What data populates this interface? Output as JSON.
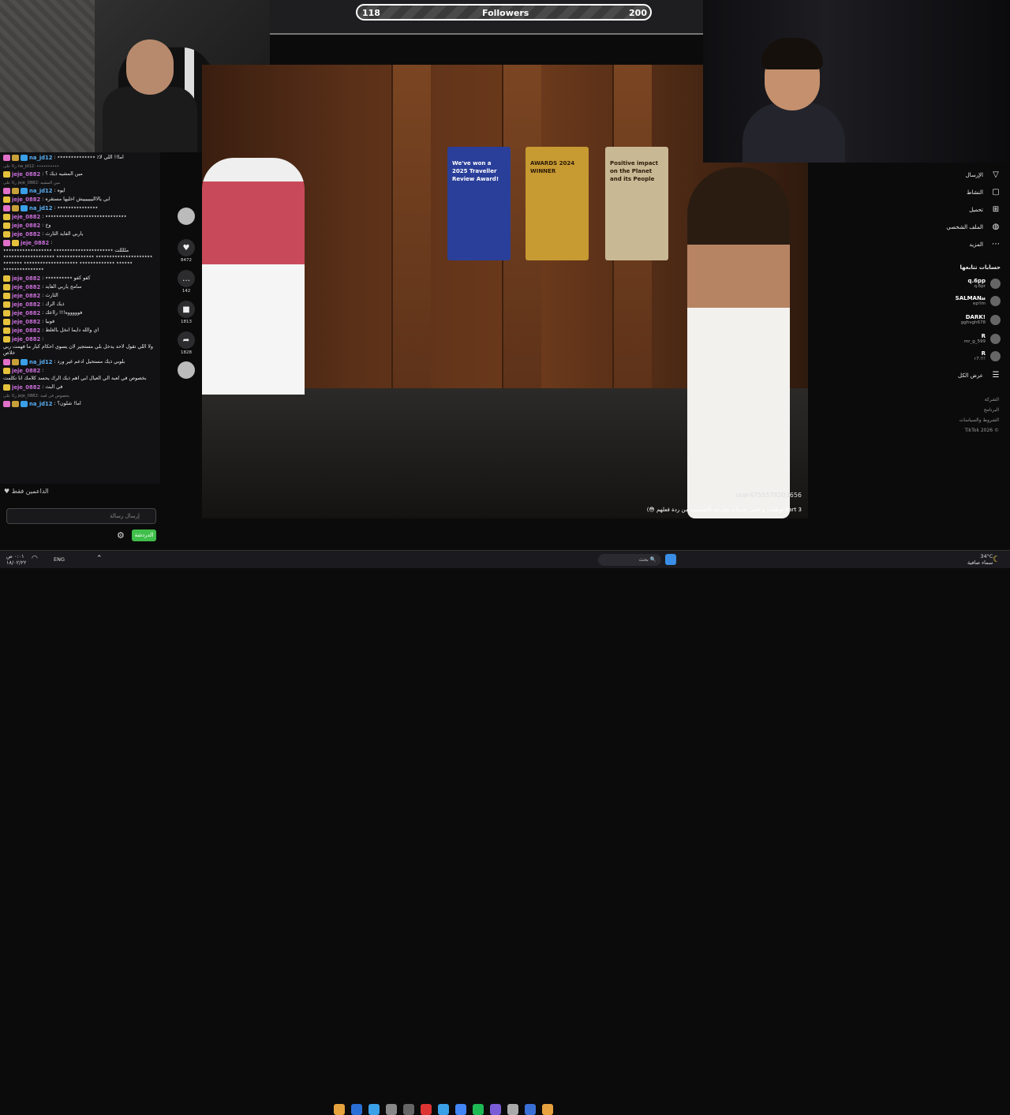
{
  "follower_goal": {
    "current": "118",
    "label": "Followers",
    "target": "200",
    "progress": 0.59
  },
  "chat": {
    "messages": [
      {
        "reply": "",
        "user": "na_jd12",
        "text": "اما!! اللي لا٪ ٭٭٭٭٭٭٭٭٭٭٭٭٭٭",
        "badges": [
          "pink",
          "gold",
          "blue"
        ]
      },
      {
        "reply": "ردًا على na_jd12: ٭٭٭٭٭٭٭٭٭٭",
        "user": "jeje_0882",
        "text": "مين المشيه ذيك ؟",
        "badges": [
          "yel"
        ]
      },
      {
        "reply": "ردًا على jeje_0882: مين المشيه",
        "user": "na_jd12",
        "text": "ايوه",
        "badges": [
          "pink",
          "gold",
          "blue"
        ]
      },
      {
        "reply": "",
        "user": "jeje_0882",
        "text": "ابي يالااليييييييش اخليها مستقره",
        "badges": [
          "yel"
        ]
      },
      {
        "reply": "",
        "user": "na_jd12",
        "text": "٭٭٭٭٭٭٭٭٭٭٭٭٭٭٭",
        "badges": [
          "pink",
          "gold",
          "blue"
        ]
      },
      {
        "reply": "",
        "user": "jeje_0882",
        "text": "٭٭٭٭٭٭٭٭٭٭٭٭٭٭٭٭٭٭٭٭٭٭٭٭٭٭٭٭٭٭",
        "badges": [
          "yel"
        ]
      },
      {
        "reply": "",
        "user": "jeje_0882",
        "text": "وخ",
        "badges": [
          "yel"
        ]
      },
      {
        "reply": "",
        "user": "jeje_0882",
        "text": "ياربي الفايد الثارث",
        "badges": [
          "yel"
        ]
      },
      {
        "reply": "",
        "user": "jeje_0882",
        "text": "مللللت ٭٭٭٭٭٭٭٭٭٭٭٭٭٭٭٭٭٭٭٭٭٭ ٭٭٭٭٭٭٭٭٭٭٭٭٭٭٭٭٭٭ ٭٭٭٭٭٭٭٭٭٭٭٭٭٭٭٭٭٭٭٭٭ ٭٭٭٭٭٭٭٭٭٭٭٭٭٭ ٭٭٭٭٭٭٭٭٭٭٭٭٭٭٭٭٭٭٭ ٭٭٭٭٭٭ ٭٭٭٭٭٭٭٭٭٭٭٭٭ ٭٭٭٭٭٭٭٭٭٭٭٭٭٭٭٭٭٭٭٭ ٭٭٭٭٭٭٭ ٭٭٭٭٭٭٭٭٭٭٭٭٭٭٭",
        "badges": [
          "pink",
          "yel"
        ]
      },
      {
        "reply": "",
        "user": "jeje_0882",
        "text": "كفو كفو ٭٭٭٭٭٭٭٭٭٭",
        "badges": [
          "yel"
        ]
      },
      {
        "reply": "",
        "user": "jeje_0882",
        "text": "سامح ياربي الفايد",
        "badges": [
          "yel"
        ]
      },
      {
        "reply": "",
        "user": "jeje_0882",
        "text": "الثارث",
        "badges": [
          "yel"
        ]
      },
      {
        "reply": "",
        "user": "jeje_0882",
        "text": "ذيك الرك",
        "badges": [
          "yel"
        ]
      },
      {
        "reply": "",
        "user": "jeje_0882",
        "text": "فوووووه!!! رااعك",
        "badges": [
          "yel"
        ]
      },
      {
        "reply": "",
        "user": "jeje_0882",
        "text": "فوبيا",
        "badges": [
          "yel"
        ]
      },
      {
        "reply": "",
        "user": "jeje_0882",
        "text": "اي والله دايما انخل بالغلط",
        "badges": [
          "yel"
        ]
      },
      {
        "reply": "",
        "user": "jeje_0882",
        "text": "ولا اللي تقول لاحد يدخل بلي مستجير لان يسوي احكام كبار ما فهمت ربي خلاص",
        "badges": [
          "yel"
        ]
      },
      {
        "reply": "",
        "user": "na_jd12",
        "text": "بلوبي ذيك مستحيل ادعم غير ورد",
        "badges": [
          "pink",
          "gold",
          "blue"
        ]
      },
      {
        "reply": "",
        "user": "jeje_0882",
        "text": "بخصوص في لعبة الي العيال ابي اهم ذيك الرك يحسد كلامك انا تكلمت",
        "badges": [
          "yel"
        ]
      },
      {
        "reply": "",
        "user": "jeje_0882",
        "text": "في البث",
        "badges": [
          "yel"
        ]
      },
      {
        "reply": "ردًا على jeje_0882: بخصوص في لعبة",
        "user": "na_jd12",
        "text": "اما! شلون؟",
        "badges": [
          "pink",
          "gold",
          "blue"
        ]
      }
    ],
    "supporters_label": "الداعمين فقط",
    "input_placeholder": "إرسال رسالة",
    "send_button": "الدردشة"
  },
  "video": {
    "actions": [
      {
        "name": "like",
        "icon": "♥",
        "count": "8472"
      },
      {
        "name": "comment",
        "icon": "…",
        "count": "142"
      },
      {
        "name": "save",
        "icon": "■",
        "count": "1813"
      },
      {
        "name": "share",
        "icon": "➦",
        "count": "1828"
      }
    ],
    "plaques": [
      {
        "color": "#2a3f9a",
        "text": "We've won a 2025 Traveller Review Award!"
      },
      {
        "color": "#c79a32",
        "text": "AWARDS 2024 WINNER"
      },
      {
        "color": "#c9b894",
        "text": "Positive impact on the Planet and its People"
      }
    ],
    "caption_user": "user4755578203656",
    "caption_text": "توظفت و جتني تحديات محرجه (أتصدمت من ردة فعلهم 😳) Part 3"
  },
  "right_nav": {
    "items": [
      {
        "label": "الإرسال",
        "icon": "▽"
      },
      {
        "label": "النشاط",
        "icon": "▢"
      },
      {
        "label": "تحميل",
        "icon": "⊞"
      },
      {
        "label": "الملف الشخصي",
        "icon": "◍"
      },
      {
        "label": "المزيد",
        "icon": "⋯"
      }
    ],
    "following_title": "حسابات تتابعها",
    "following": [
      {
        "name": "q.6pp",
        "handle": "q.6pr"
      },
      {
        "name": "SALMAN𝓈𝓈",
        "handle": "ep!lm"
      },
      {
        "name": "DARK!",
        "handle": "gghvgh678"
      },
      {
        "name": "R",
        "handle": "mr_g_599"
      },
      {
        "name": "R",
        "handle": "r7.!!!"
      }
    ],
    "see_all": "عرض الكل",
    "footer": [
      "الشركة",
      "البرنامج",
      "الشروط والسياسات",
      "TikTok 2026 ©"
    ]
  },
  "taskbar": {
    "time": "٠:٠١ ص",
    "date": "١٨/٠٢/٢٢",
    "lang": "ENG",
    "search": "بحث",
    "weather_temp": "34°C",
    "weather_desc": "سماء صافية"
  }
}
